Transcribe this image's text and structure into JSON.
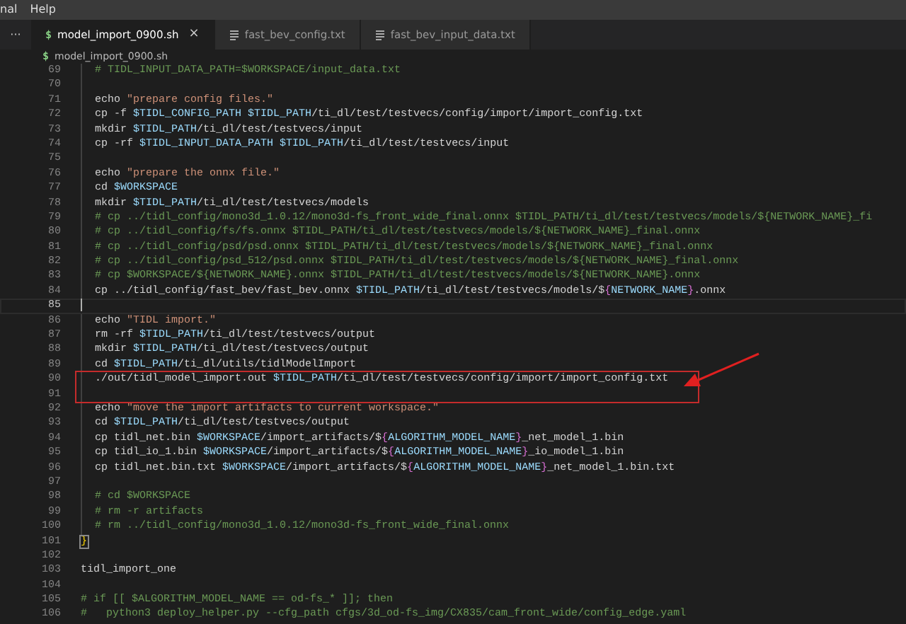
{
  "menu_bar": [
    "nal",
    "Help"
  ],
  "tab_bar": {
    "more": "···",
    "tabs": [
      {
        "label": "model_import_0900.sh",
        "kind": "shell",
        "glyph": "$",
        "selected": true,
        "close": "×"
      },
      {
        "label": "fast_bev_config.txt",
        "kind": "text",
        "selected": false
      },
      {
        "label": "fast_bev_input_data.txt",
        "kind": "text",
        "selected": false
      }
    ]
  },
  "breadcrumb": {
    "kind": "shell",
    "glyph": "$",
    "label": "model_import_0900.sh"
  },
  "editor": {
    "lines": [
      {
        "number": "69",
        "indented": true,
        "current": false,
        "boxed": false,
        "segments": [
          {
            "kind": "comment",
            "text": "# TIDL_INPUT_DATA_PATH=$WORKSPACE/input_data.txt"
          }
        ]
      },
      {
        "number": "70",
        "indented": true,
        "current": false,
        "boxed": false
      },
      {
        "number": "71",
        "indented": true,
        "current": false,
        "boxed": false,
        "segments": [
          {
            "kind": "plain",
            "text": "echo "
          },
          {
            "kind": "string",
            "text": "\"prepare config files.\""
          }
        ]
      },
      {
        "number": "72",
        "indented": true,
        "current": false,
        "boxed": false,
        "segments": [
          {
            "kind": "plain",
            "text": "cp -f "
          },
          {
            "kind": "variable",
            "text": "$TIDL_CONFIG_PATH "
          },
          {
            "kind": "variable",
            "text": "$TIDL_PATH"
          },
          {
            "kind": "plain",
            "text": "/ti_dl/test/testvecs/config/import/import_config.txt"
          }
        ]
      },
      {
        "number": "73",
        "indented": true,
        "current": false,
        "boxed": false,
        "segments": [
          {
            "kind": "plain",
            "text": "mkdir "
          },
          {
            "kind": "variable",
            "text": "$TIDL_PATH"
          },
          {
            "kind": "plain",
            "text": "/ti_dl/test/testvecs/input"
          }
        ]
      },
      {
        "number": "74",
        "indented": true,
        "current": false,
        "boxed": false,
        "segments": [
          {
            "kind": "plain",
            "text": "cp -rf "
          },
          {
            "kind": "variable",
            "text": "$TIDL_INPUT_DATA_PATH "
          },
          {
            "kind": "variable",
            "text": "$TIDL_PATH"
          },
          {
            "kind": "plain",
            "text": "/ti_dl/test/testvecs/input"
          }
        ]
      },
      {
        "number": "75",
        "indented": true,
        "current": false,
        "boxed": false
      },
      {
        "number": "76",
        "indented": true,
        "current": false,
        "boxed": false,
        "segments": [
          {
            "kind": "plain",
            "text": "echo "
          },
          {
            "kind": "string",
            "text": "\"prepare the onnx file.\""
          }
        ]
      },
      {
        "number": "77",
        "indented": true,
        "current": false,
        "boxed": false,
        "segments": [
          {
            "kind": "plain",
            "text": "cd "
          },
          {
            "kind": "variable",
            "text": "$WORKSPACE"
          }
        ]
      },
      {
        "number": "78",
        "indented": true,
        "current": false,
        "boxed": false,
        "segments": [
          {
            "kind": "plain",
            "text": "mkdir "
          },
          {
            "kind": "variable",
            "text": "$TIDL_PATH"
          },
          {
            "kind": "plain",
            "text": "/ti_dl/test/testvecs/models"
          }
        ]
      },
      {
        "number": "79",
        "indented": true,
        "current": false,
        "boxed": false,
        "segments": [
          {
            "kind": "comment",
            "text": "# cp ../tidl_config/mono3d_1.0.12/mono3d-fs_front_wide_final.onnx $TIDL_PATH/ti_dl/test/testvecs/models/${NETWORK_NAME}_fi"
          }
        ]
      },
      {
        "number": "80",
        "indented": true,
        "current": false,
        "boxed": false,
        "segments": [
          {
            "kind": "comment",
            "text": "# cp ../tidl_config/fs/fs.onnx $TIDL_PATH/ti_dl/test/testvecs/models/${NETWORK_NAME}_final.onnx"
          }
        ]
      },
      {
        "number": "81",
        "indented": true,
        "current": false,
        "boxed": false,
        "segments": [
          {
            "kind": "comment",
            "text": "# cp ../tidl_config/psd/psd.onnx $TIDL_PATH/ti_dl/test/testvecs/models/${NETWORK_NAME}_final.onnx"
          }
        ]
      },
      {
        "number": "82",
        "indented": true,
        "current": false,
        "boxed": false,
        "segments": [
          {
            "kind": "comment",
            "text": "# cp ../tidl_config/psd_512/psd.onnx $TIDL_PATH/ti_dl/test/testvecs/models/${NETWORK_NAME}_final.onnx"
          }
        ]
      },
      {
        "number": "83",
        "indented": true,
        "current": false,
        "boxed": false,
        "segments": [
          {
            "kind": "comment",
            "text": "# cp $WORKSPACE/${NETWORK_NAME}.onnx $TIDL_PATH/ti_dl/test/testvecs/models/${NETWORK_NAME}.onnx"
          }
        ]
      },
      {
        "number": "84",
        "indented": true,
        "current": false,
        "boxed": false,
        "segments": [
          {
            "kind": "plain",
            "text": "cp ../tidl_config/fast_bev/fast_bev.onnx "
          },
          {
            "kind": "variable",
            "text": "$TIDL_PATH"
          },
          {
            "kind": "plain",
            "text": "/ti_dl/test/testvecs/models/$"
          },
          {
            "kind": "brace",
            "text": "{"
          },
          {
            "kind": "variable",
            "text": "NETWORK_NAME"
          },
          {
            "kind": "brace",
            "text": "}"
          },
          {
            "kind": "plain",
            "text": ".onnx"
          }
        ]
      },
      {
        "number": "85",
        "indented": false,
        "current": true,
        "boxed": false
      },
      {
        "number": "86",
        "indented": true,
        "current": false,
        "boxed": false,
        "segments": [
          {
            "kind": "plain",
            "text": "echo "
          },
          {
            "kind": "string",
            "text": "\"TIDL import.\""
          }
        ]
      },
      {
        "number": "87",
        "indented": true,
        "current": false,
        "boxed": false,
        "segments": [
          {
            "kind": "plain",
            "text": "rm -rf "
          },
          {
            "kind": "variable",
            "text": "$TIDL_PATH"
          },
          {
            "kind": "plain",
            "text": "/ti_dl/test/testvecs/output"
          }
        ]
      },
      {
        "number": "88",
        "indented": true,
        "current": false,
        "boxed": false,
        "segments": [
          {
            "kind": "plain",
            "text": "mkdir "
          },
          {
            "kind": "variable",
            "text": "$TIDL_PATH"
          },
          {
            "kind": "plain",
            "text": "/ti_dl/test/testvecs/output"
          }
        ]
      },
      {
        "number": "89",
        "indented": true,
        "current": false,
        "boxed": false,
        "segments": [
          {
            "kind": "plain",
            "text": "cd "
          },
          {
            "kind": "variable",
            "text": "$TIDL_PATH"
          },
          {
            "kind": "plain",
            "text": "/ti_dl/utils/tidlModelImport"
          }
        ]
      },
      {
        "number": "90",
        "indented": true,
        "current": false,
        "boxed": true,
        "segments": [
          {
            "kind": "plain",
            "text": "./out/tidl_model_import.out "
          },
          {
            "kind": "variable",
            "text": "$TIDL_PATH"
          },
          {
            "kind": "plain",
            "text": "/ti_dl/test/testvecs/config/import/import_config.txt"
          }
        ]
      },
      {
        "number": "91",
        "indented": true,
        "current": false,
        "boxed": true
      },
      {
        "number": "92",
        "indented": true,
        "current": false,
        "boxed": false,
        "segments": [
          {
            "kind": "plain",
            "text": "echo "
          },
          {
            "kind": "string",
            "text": "\"move the import artifacts to current workspace.\""
          }
        ]
      },
      {
        "number": "93",
        "indented": true,
        "current": false,
        "boxed": false,
        "segments": [
          {
            "kind": "plain",
            "text": "cd "
          },
          {
            "kind": "variable",
            "text": "$TIDL_PATH"
          },
          {
            "kind": "plain",
            "text": "/ti_dl/test/testvecs/output"
          }
        ]
      },
      {
        "number": "94",
        "indented": true,
        "current": false,
        "boxed": false,
        "segments": [
          {
            "kind": "plain",
            "text": "cp tidl_net.bin "
          },
          {
            "kind": "variable",
            "text": "$WORKSPACE"
          },
          {
            "kind": "plain",
            "text": "/import_artifacts/$"
          },
          {
            "kind": "brace",
            "text": "{"
          },
          {
            "kind": "variable",
            "text": "ALGORITHM_MODEL_NAME"
          },
          {
            "kind": "brace",
            "text": "}"
          },
          {
            "kind": "plain",
            "text": "_net_model_1.bin"
          }
        ]
      },
      {
        "number": "95",
        "indented": true,
        "current": false,
        "boxed": false,
        "segments": [
          {
            "kind": "plain",
            "text": "cp tidl_io_1.bin "
          },
          {
            "kind": "variable",
            "text": "$WORKSPACE"
          },
          {
            "kind": "plain",
            "text": "/import_artifacts/$"
          },
          {
            "kind": "brace",
            "text": "{"
          },
          {
            "kind": "variable",
            "text": "ALGORITHM_MODEL_NAME"
          },
          {
            "kind": "brace",
            "text": "}"
          },
          {
            "kind": "plain",
            "text": "_io_model_1.bin"
          }
        ]
      },
      {
        "number": "96",
        "indented": true,
        "current": false,
        "boxed": false,
        "segments": [
          {
            "kind": "plain",
            "text": "cp tidl_net.bin.txt "
          },
          {
            "kind": "variable",
            "text": "$WORKSPACE"
          },
          {
            "kind": "plain",
            "text": "/import_artifacts/$"
          },
          {
            "kind": "brace",
            "text": "{"
          },
          {
            "kind": "variable",
            "text": "ALGORITHM_MODEL_NAME"
          },
          {
            "kind": "brace",
            "text": "}"
          },
          {
            "kind": "plain",
            "text": "_net_model_1.bin.txt"
          }
        ]
      },
      {
        "number": "97",
        "indented": true,
        "current": false,
        "boxed": false
      },
      {
        "number": "98",
        "indented": true,
        "current": false,
        "boxed": false,
        "segments": [
          {
            "kind": "comment",
            "text": "# cd $WORKSPACE"
          }
        ]
      },
      {
        "number": "99",
        "indented": true,
        "current": false,
        "boxed": false,
        "segments": [
          {
            "kind": "comment",
            "text": "# rm -r artifacts"
          }
        ]
      },
      {
        "number": "100",
        "indented": true,
        "current": false,
        "boxed": false,
        "segments": [
          {
            "kind": "comment",
            "text": "# rm ../tidl_config/mono3d_1.0.12/mono3d-fs_front_wide_final.onnx"
          }
        ]
      },
      {
        "number": "101",
        "indented": false,
        "current": false,
        "boxed": false,
        "segments": [
          {
            "kind": "matched-bracket",
            "text": "}"
          }
        ]
      },
      {
        "number": "102",
        "indented": false,
        "current": false,
        "boxed": false
      },
      {
        "number": "103",
        "indented": false,
        "current": false,
        "boxed": false,
        "segments": [
          {
            "kind": "plain",
            "text": "tidl_import_one"
          }
        ]
      },
      {
        "number": "104",
        "indented": false,
        "current": false,
        "boxed": false
      },
      {
        "number": "105",
        "indented": false,
        "current": false,
        "boxed": false,
        "segments": [
          {
            "kind": "comment",
            "text": "# if [[ $ALGORITHM_MODEL_NAME == od-fs_* ]]; then"
          }
        ]
      },
      {
        "number": "106",
        "indented": false,
        "current": false,
        "boxed": false,
        "segments": [
          {
            "kind": "comment",
            "text": "#   python3 deploy_helper.py --cfg_path cfgs/3d_od-fs_img/CX835/cam_front_wide/config_edge.yaml"
          }
        ]
      }
    ]
  }
}
